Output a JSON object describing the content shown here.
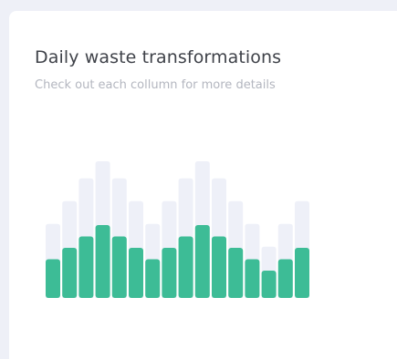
{
  "card": {
    "title": "Daily waste transformations",
    "subtitle": "Check out each collumn for more details"
  },
  "colors": {
    "page_background": "#eef0f7",
    "card_background": "#ffffff",
    "bar_fill": "#3dbc96",
    "bar_track": "#eef0f8"
  },
  "chart_data": {
    "type": "bar",
    "title": "Daily waste transformations",
    "subtitle": "Check out each collumn for more details",
    "xlabel": "",
    "ylabel": "",
    "axes_visible": false,
    "grid": false,
    "ylim": [
      0,
      10
    ],
    "bar_count": 16,
    "series": [
      {
        "role": "background",
        "values": [
          6.5,
          8.5,
          10.5,
          12,
          10.5,
          8.5,
          6.5,
          8.5,
          10.5,
          12,
          10.5,
          8.5,
          6.5,
          4.5,
          6.5,
          8.5
        ]
      },
      {
        "role": "foreground",
        "values": [
          3.4,
          4.4,
          5.4,
          6.4,
          5.4,
          4.4,
          3.4,
          4.4,
          5.4,
          6.4,
          5.4,
          4.4,
          3.4,
          2.4,
          3.4,
          4.4
        ]
      }
    ]
  }
}
